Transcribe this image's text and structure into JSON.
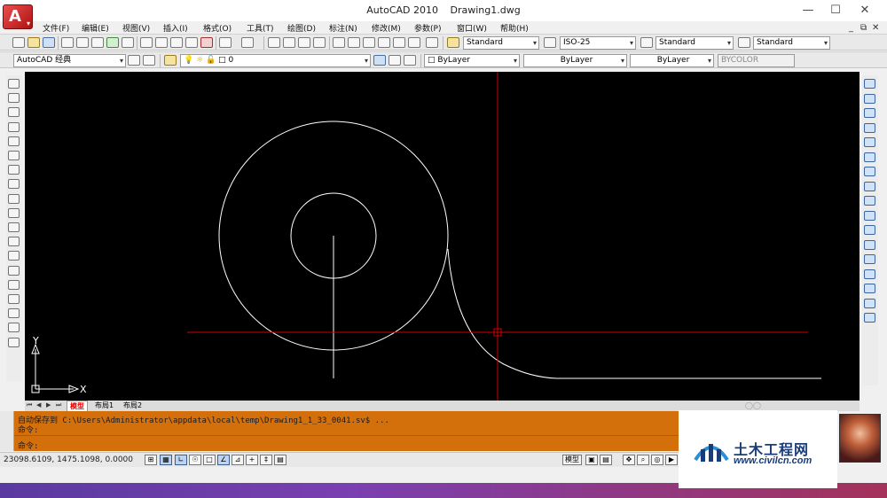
{
  "window": {
    "app_name": "AutoCAD 2010",
    "document": "Drawing1.dwg",
    "minimize": "—",
    "maximize": "☐",
    "close": "✕",
    "logo_letter": "A"
  },
  "menu": {
    "items": [
      "文件(F)",
      "编辑(E)",
      "视图(V)",
      "插入(I)",
      "格式(O)",
      "工具(T)",
      "绘图(D)",
      "标注(N)",
      "修改(M)",
      "参数(P)",
      "窗口(W)",
      "帮助(H)"
    ],
    "doc_controls": [
      "_",
      "⧉",
      "✕"
    ]
  },
  "styles_toolbar": {
    "text_style": "Standard",
    "dim_style": "ISO-25",
    "table_style": "Standard",
    "multileader_style": "Standard"
  },
  "layers_toolbar": {
    "workspace": "AutoCAD 经典",
    "current_layer": "0",
    "color": "ByLayer",
    "linetype": "ByLayer",
    "lineweight": "ByLayer",
    "plot_style": "BYCOLOR"
  },
  "drawing": {
    "axis_x_label": "X",
    "axis_y_label": "Y",
    "crosshair_color": "#d00000",
    "geometry_color": "#ffffff"
  },
  "layout_tabs": {
    "nav": [
      "⏮",
      "◀",
      "▶",
      "⏭"
    ],
    "tabs": [
      "模型",
      "布局1",
      "布局2"
    ],
    "active": "模型"
  },
  "command_line": {
    "line1": "自动保存到 C:\\Users\\Administrator\\appdata\\local\\temp\\Drawing1_1_33_0041.sv$ ...",
    "line2": "命令:",
    "line3": "命令:",
    "background": "#d4700c"
  },
  "status_bar": {
    "coordinates": "23098.6109, 1475.1098, 0.0000",
    "model_label": "模型"
  },
  "overlay": {
    "site_title": "土木工程网",
    "site_url": "www.civilcn.com"
  },
  "left_tool_icons": [
    "line-icon",
    "construction-line-icon",
    "polyline-icon",
    "polygon-icon",
    "rectangle-icon",
    "arc-icon",
    "circle-icon",
    "revision-cloud-icon",
    "spline-icon",
    "ellipse-icon",
    "ellipse-arc-icon",
    "insert-block-icon",
    "make-block-icon",
    "point-icon",
    "hatch-icon",
    "gradient-icon",
    "region-icon",
    "table-icon",
    "multiline-text-icon"
  ],
  "right_tool_icons": [
    "erase-icon",
    "copy-icon",
    "mirror-icon",
    "offset-icon",
    "array-icon",
    "move-icon",
    "rotate-icon",
    "scale-icon",
    "stretch-icon",
    "trim-icon",
    "extend-icon",
    "break-at-point-icon",
    "break-icon",
    "join-icon",
    "chamfer-icon",
    "fillet-icon",
    "explode-icon"
  ]
}
